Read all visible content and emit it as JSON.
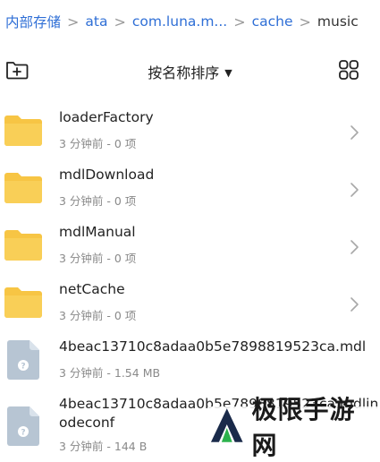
{
  "breadcrumb": {
    "items": [
      "内部存储",
      "ata",
      "com.luna.m...",
      "cache",
      "music"
    ],
    "separator": ">"
  },
  "toolbar": {
    "sort_label": "按名称排序",
    "sort_caret": "▼",
    "left_icon": "new-folder-icon",
    "right_icon": "grid-view-icon"
  },
  "files": [
    {
      "name": "loaderFactory",
      "meta": "3 分钟前 - 0 项",
      "type": "folder"
    },
    {
      "name": "mdlDownload",
      "meta": "3 分钟前 - 0 项",
      "type": "folder"
    },
    {
      "name": "mdlManual",
      "meta": "3 分钟前 - 0 项",
      "type": "folder"
    },
    {
      "name": "netCache",
      "meta": "3 分钟前 - 0 项",
      "type": "folder"
    },
    {
      "name": "4beac13710c8adaa0b5e7898819523ca.mdl",
      "meta": "3 分钟前 - 1.54 MB",
      "type": "file"
    },
    {
      "name_line1": "4beac13710c8adaa0b5e7898819523ca.mdlin",
      "name_line2": "odeconf",
      "meta": "3 分钟前 - 144 B",
      "type": "file"
    }
  ],
  "watermark": {
    "text": "极限手游网"
  },
  "colors": {
    "accent": "#2f6fd6",
    "folder": "#f7c544",
    "file_icon": "#b7c5d3"
  }
}
